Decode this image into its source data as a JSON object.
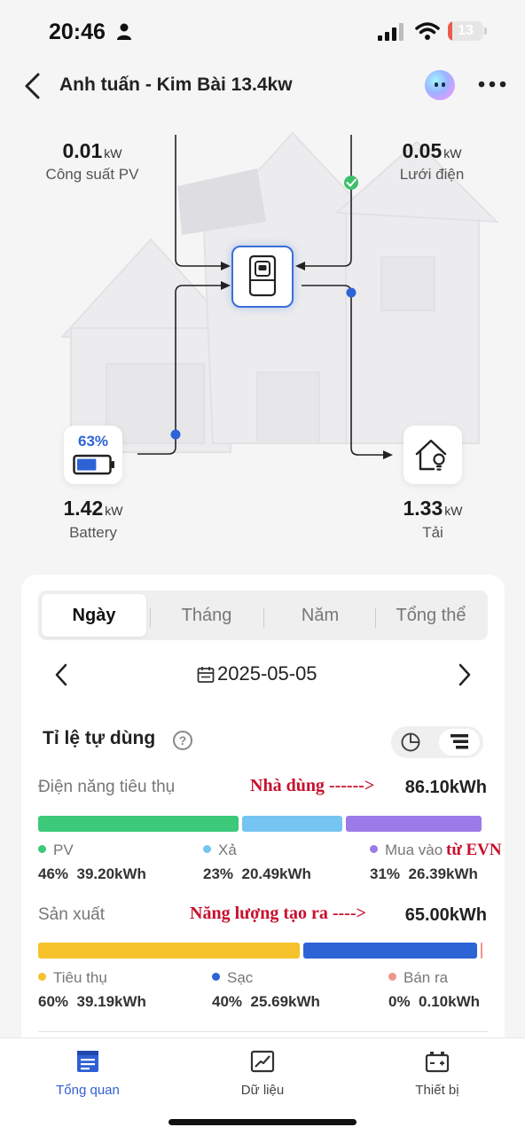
{
  "status_bar": {
    "time": "20:46",
    "battery": "13",
    "battery_level": 0.13
  },
  "header": {
    "title": "Anh tuấn - Kim Bài 13.4kw"
  },
  "flow": {
    "pv": {
      "value": "0.01",
      "unit": "kW",
      "label": "Công suất PV"
    },
    "grid": {
      "value": "0.05",
      "unit": "kW",
      "label": "Lưới điện"
    },
    "battery": {
      "percent": "63%",
      "level": 0.63,
      "value": "1.42",
      "unit": "kW",
      "label": "Battery"
    },
    "load": {
      "value": "1.33",
      "unit": "kW",
      "label": "Tải"
    }
  },
  "period_tabs": [
    "Ngày",
    "Tháng",
    "Năm",
    "Tổng thể"
  ],
  "active_tab": 0,
  "date": "2025-05-05",
  "section_title": "Tỉ lệ tự dùng",
  "consumption": {
    "label": "Điện năng tiêu thụ",
    "annotation": "Nhà dùng ------>",
    "total": "86.10kWh",
    "segments": [
      {
        "name": "PV",
        "percent": "46%",
        "value": "39.20kWh",
        "share": 46,
        "color": "#3cc97a"
      },
      {
        "name": "Xả",
        "percent": "23%",
        "value": "20.49kWh",
        "share": 23,
        "color": "#76c4f1"
      },
      {
        "name": "Mua vào",
        "percent": "31%",
        "value": "26.39kWh",
        "share": 31,
        "color": "#9b7be8"
      }
    ],
    "side_note": "từ EVN"
  },
  "production": {
    "label": "Sản xuất",
    "annotation": "Năng lượng tạo ra ---->",
    "total": "65.00kWh",
    "segments": [
      {
        "name": "Tiêu thụ",
        "percent": "60%",
        "value": "39.19kWh",
        "share": 60,
        "color": "#f6c22b"
      },
      {
        "name": "Sạc",
        "percent": "40%",
        "value": "25.69kWh",
        "share": 40,
        "color": "#2e63d6"
      },
      {
        "name": "Bán ra",
        "percent": "0%",
        "value": "0.10kWh",
        "share": 0.2,
        "color": "#f0958a"
      }
    ]
  },
  "bottom_nav": [
    {
      "label": "Tổng quan",
      "icon": "overview-icon"
    },
    {
      "label": "Dữ liệu",
      "icon": "data-chart-icon"
    },
    {
      "label": "Thiết bị",
      "icon": "device-battery-icon"
    }
  ],
  "active_nav": 0,
  "colors": {
    "accent": "#2e63d6",
    "inverter_border": "#3a6fd8",
    "flow_dot": "#2e63d6",
    "ok_dot": "#3ec06a"
  }
}
